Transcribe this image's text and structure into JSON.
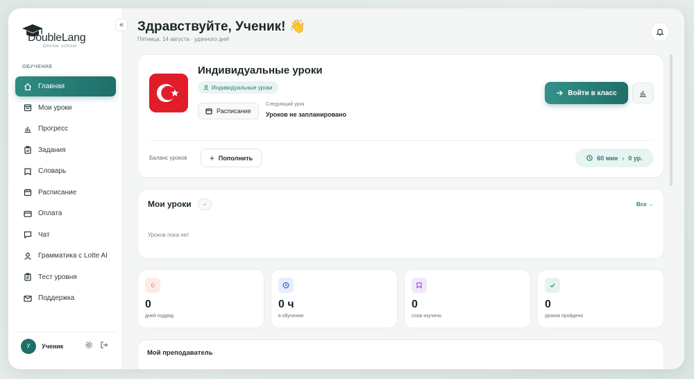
{
  "brand": {
    "logo_text": "DoubleLang",
    "logo_sub": "Online school"
  },
  "sidebar": {
    "section_label": "ОБУЧЕНИЕ",
    "items": [
      {
        "label": "Главная",
        "icon": "home-icon",
        "active": true
      },
      {
        "label": "Мои уроки",
        "icon": "book-icon"
      },
      {
        "label": "Прогресс",
        "icon": "chart-icon"
      },
      {
        "label": "Задания",
        "icon": "clipboard-icon"
      },
      {
        "label": "Словарь",
        "icon": "dictionary-icon"
      },
      {
        "label": "Расписание",
        "icon": "calendar-icon"
      },
      {
        "label": "Оплата",
        "icon": "card-icon"
      },
      {
        "label": "Чат",
        "icon": "chat-icon"
      },
      {
        "label": "Грамматика с Lotte AI",
        "icon": "user-ai-icon"
      },
      {
        "label": "Тест уровня",
        "icon": "test-icon"
      },
      {
        "label": "Поддержка",
        "icon": "mail-icon"
      }
    ],
    "user": {
      "initial": "У",
      "name": "Ученик"
    },
    "collapse_glyph": "«"
  },
  "header": {
    "greeting": "Здравствуйте, Ученик! 👋",
    "subline": "Пятница, 14 августа · удачного дня!"
  },
  "course": {
    "title": "Индивидуальные уроки",
    "tag": "Индивидуальные уроки",
    "schedule_button": "Расписание",
    "next_label": "Следующий урок",
    "next_value": "Уроков не запланировано",
    "enter_button": "Войти в класс",
    "balance_label": "Баланс уроков",
    "topup_button": "Пополнить",
    "balance_minutes": "60 мин",
    "balance_sep": "›",
    "balance_lessons": "0 ур."
  },
  "lessons": {
    "title": "Мои уроки",
    "badge": "–",
    "all_link": "Все →",
    "empty": "Уроков пока нет"
  },
  "stats": [
    {
      "value": "0",
      "label": "дней подряд",
      "icon": "fire-icon",
      "color": "#f26b3a",
      "bg": "#fdece4",
      "glyph": "0"
    },
    {
      "value": "0 ч",
      "label": "в обучении",
      "icon": "clock-icon",
      "color": "#3f6fd8",
      "bg": "#e6edfb"
    },
    {
      "value": "0",
      "label": "слов изучено",
      "icon": "bookmark-icon",
      "color": "#9b5cd6",
      "bg": "#f1e8fb"
    },
    {
      "value": "0",
      "label": "уроков пройдено",
      "icon": "check-icon",
      "color": "#2b9a6e",
      "bg": "#e4f4ec"
    }
  ],
  "teacher": {
    "title": "Мой преподаватель"
  },
  "colors": {
    "accent": "#1f6e69",
    "accent_light": "#e8f4f1",
    "flag_red": "#e11d2a"
  }
}
